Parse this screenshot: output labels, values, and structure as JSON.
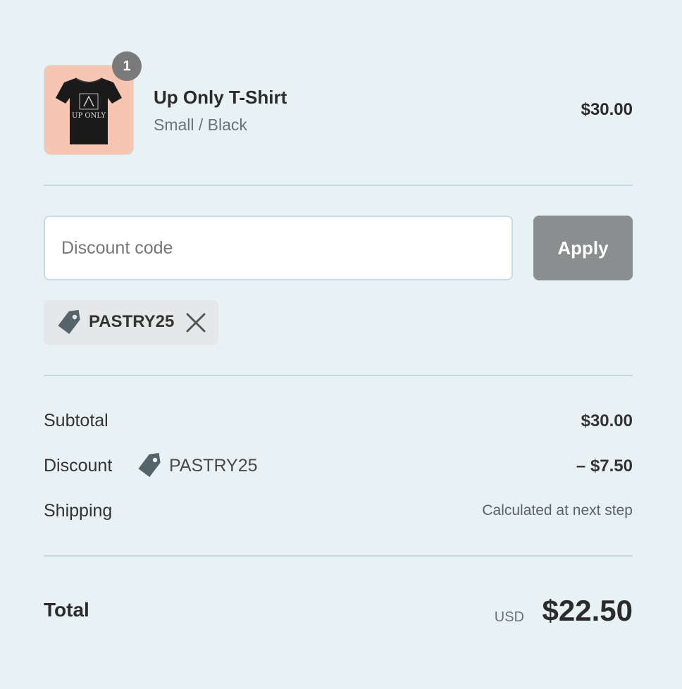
{
  "product": {
    "quantity": "1",
    "name": "Up Only T-Shirt",
    "variant": "Small / Black",
    "price": "$30.00",
    "thumbnail_icon": "tshirt-icon",
    "thumbnail_bg": "#f7c6b3",
    "shirt_print": "UP ONLY"
  },
  "discount": {
    "placeholder": "Discount code",
    "value": "",
    "apply_label": "Apply",
    "applied_code": "PASTRY25",
    "tag_icon": "tag-icon",
    "remove_icon": "close-icon"
  },
  "summary": {
    "subtotal_label": "Subtotal",
    "subtotal_value": "$30.00",
    "discount_label": "Discount",
    "discount_code": "PASTRY25",
    "discount_value": "– $7.50",
    "shipping_label": "Shipping",
    "shipping_value": "Calculated at next step"
  },
  "total": {
    "label": "Total",
    "currency": "USD",
    "amount": "$22.50"
  },
  "colors": {
    "background": "#e8f1f4",
    "apply_button": "#8a8e8f",
    "divider": "#c2dae2",
    "chip": "#e5e8e9"
  }
}
